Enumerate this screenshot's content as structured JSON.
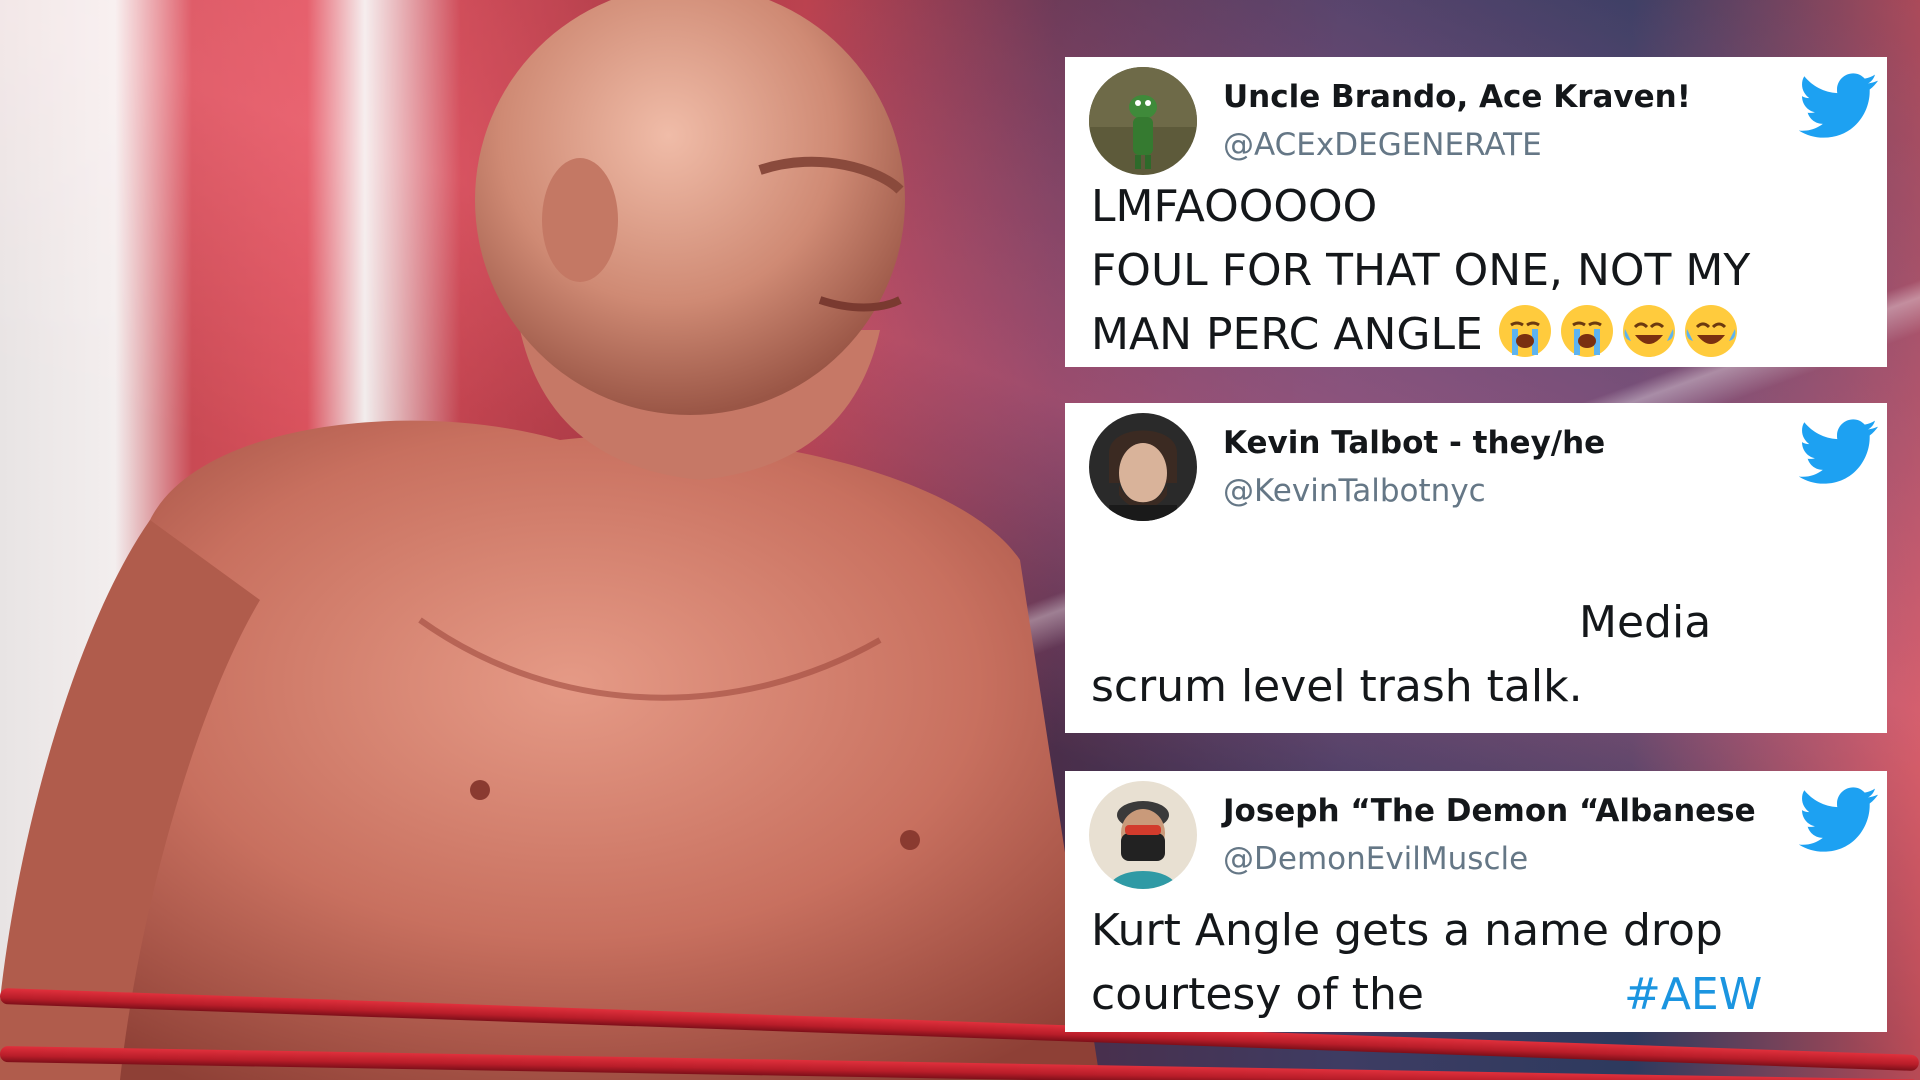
{
  "colors": {
    "twitter_blue": "#1da1f2",
    "text_primary": "#14171a",
    "text_secondary": "#657786",
    "hashtag": "#1b95e0"
  },
  "tweets": [
    {
      "display_name": "Uncle Brando, Ace Kraven!",
      "handle": "@ACExDEGENERATE",
      "lines": [
        "LMFAOOOOO",
        "FOUL FOR THAT ONE, NOT MY",
        "MAN PERC ANGLE"
      ],
      "emojis": [
        "loudly-crying-face",
        "loudly-crying-face",
        "tears-of-joy-face",
        "tears-of-joy-face"
      ],
      "icon": "twitter-bird-icon"
    },
    {
      "display_name": "Kevin Talbot - they/he",
      "handle": "@KevinTalbotnyc",
      "lines": [
        "Media",
        "scrum level trash talk."
      ],
      "icon": "twitter-bird-icon"
    },
    {
      "display_name": "Joseph “The Demon “Albanese",
      "handle": "@DemonEvilMuscle",
      "lines": [
        "Kurt Angle gets a name drop",
        "courtesy of the"
      ],
      "hashtag": "#AEW",
      "icon": "twitter-bird-icon"
    }
  ]
}
